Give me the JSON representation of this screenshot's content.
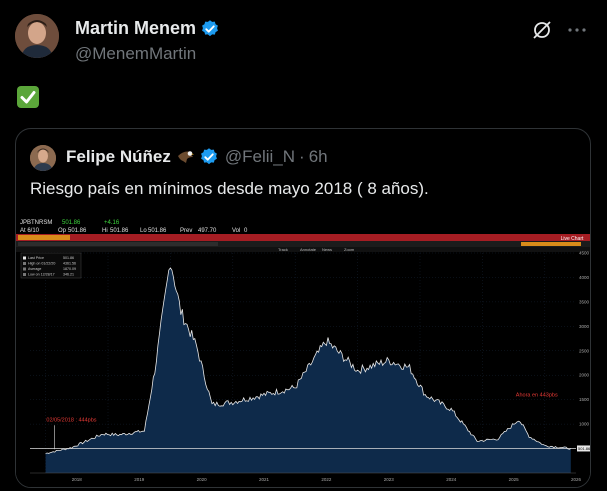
{
  "author": {
    "name": "Martin Menem",
    "handle": "@MenemMartin"
  },
  "post": {
    "emoji": "check-mark-button"
  },
  "quoted": {
    "name": "Felipe Núñez",
    "emoji": "eagle",
    "handle": "@Felii_N",
    "time_sep": "·",
    "time": "6h",
    "text": "Riesgo país en mínimos desde mayo 2018 ( 8 años)."
  },
  "terminal": {
    "ticker": "JPBTNRSM",
    "last": "501.86",
    "change": "+4.16",
    "date": "At 6/10",
    "op_label": "Op",
    "op": "501.86",
    "hi_label": "Hi",
    "hi": "501.86",
    "lo_label": "Lo",
    "lo": "501.86",
    "prev_label": "Prev",
    "prev": "497.70",
    "vol_label": "Vol",
    "vol": "0",
    "live_chart": "Live Chart",
    "legend": [
      "Last Price",
      "High on 01/22/20",
      "Average",
      "Low on 12/28/17"
    ],
    "legend_vals": [
      "501.86",
      "4361.56",
      "1870.09",
      "346.21"
    ],
    "toolbar": [
      "Track",
      "Annotate",
      "News",
      "Zoom"
    ],
    "accent": "#d4382c",
    "bar_red": "#a51d23"
  },
  "chart_data": {
    "type": "area",
    "series": [
      {
        "x": [
          "2018-01",
          "2018-06",
          "2018-12",
          "2019-03",
          "2019-08",
          "2019-10",
          "2020-01",
          "2020-03",
          "2020-06",
          "2020-09",
          "2021-01",
          "2021-07",
          "2022-01",
          "2022-07",
          "2022-10",
          "2023-01",
          "2023-07",
          "2023-11",
          "2024-02",
          "2024-07",
          "2024-12",
          "2025-04",
          "2025-08",
          "2025-10",
          "2026-01",
          "2026-06"
        ],
        "values": [
          400,
          520,
          800,
          780,
          860,
          2100,
          4361,
          3300,
          2600,
          1400,
          1450,
          1600,
          1750,
          2700,
          2400,
          2100,
          2300,
          2150,
          1600,
          1300,
          650,
          700,
          1100,
          750,
          560,
          502
        ]
      }
    ],
    "xticks": [
      "2018",
      "2019",
      "2020",
      "2021",
      "2022",
      "2023",
      "2024",
      "2025",
      "2026"
    ],
    "yticks": [
      "500",
      "1000",
      "1500",
      "2000",
      "2500",
      "3000",
      "3500",
      "4000",
      "4500"
    ],
    "ylim": [
      0,
      4500
    ],
    "annotations": [
      {
        "text": "02/05/2018 : 444pbs",
        "x": "2018-05",
        "y": 444
      },
      {
        "text": "Ahora en 443pbs",
        "x": "2026-06",
        "y": 443
      }
    ],
    "current_value": "501.86"
  }
}
